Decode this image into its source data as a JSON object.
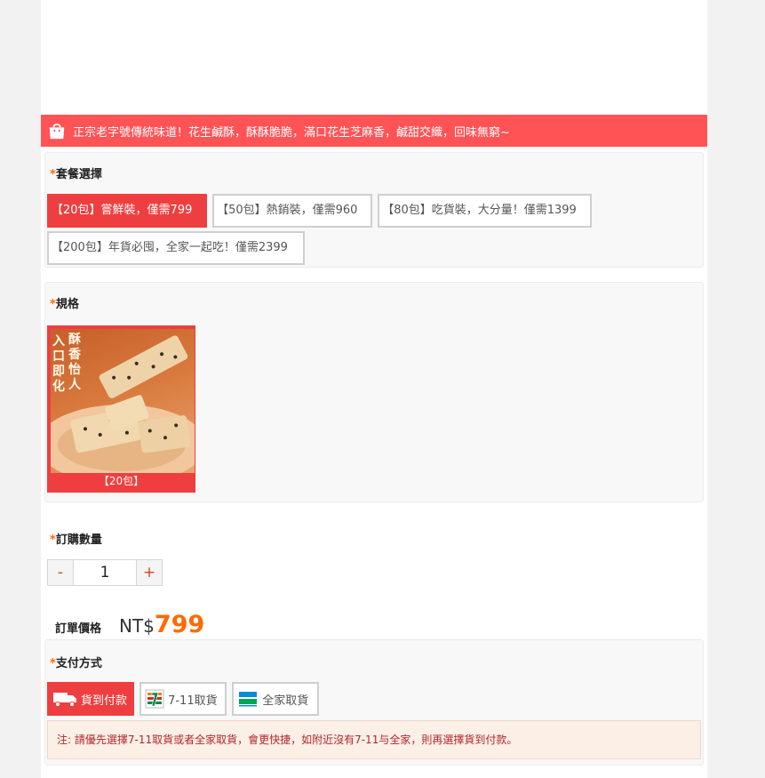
{
  "promo": {
    "text": "正宗老字號傳統味道！花生鹹酥，酥酥脆脆，滿口花生芝麻香，鹹甜交織，回味無窮~"
  },
  "package": {
    "required_mark": "*",
    "label": "套餐選擇",
    "options": [
      {
        "label": "【20包】嘗鮮裝，僅需799",
        "selected": true
      },
      {
        "label": "【50包】熱銷裝，僅需960",
        "selected": false
      },
      {
        "label": "【80包】吃貨裝，大分量！僅需1399",
        "selected": false
      },
      {
        "label": "【200包】年貨必囤，全家一起吃！僅需2399",
        "selected": false
      }
    ]
  },
  "spec": {
    "required_mark": "*",
    "label": "規格",
    "image_text_left": "入口即化",
    "image_text_right": "酥香怡人",
    "caption": "【20包】"
  },
  "quantity": {
    "required_mark": "*",
    "label": "訂購數量",
    "minus": "-",
    "value": "1",
    "plus": "+"
  },
  "price": {
    "label": "訂單價格",
    "currency": "NT$",
    "amount": "799"
  },
  "payment": {
    "required_mark": "*",
    "label": "支付方式",
    "options": [
      {
        "label": "貨到付款",
        "icon": "truck-icon",
        "selected": true
      },
      {
        "label": "7-11取貨",
        "icon": "seven-eleven-icon",
        "selected": false
      },
      {
        "label": "全家取貨",
        "icon": "familymart-icon",
        "selected": false
      }
    ],
    "note": "注: 請優先選擇7-11取貨或者全家取貨，會更快捷，如附近沒有7-11与全家，則再選擇貨到付款。"
  },
  "colors": {
    "accent_red": "#ef3e3f",
    "promo_bar": "#ff5356",
    "price_orange": "#ff6a00"
  }
}
